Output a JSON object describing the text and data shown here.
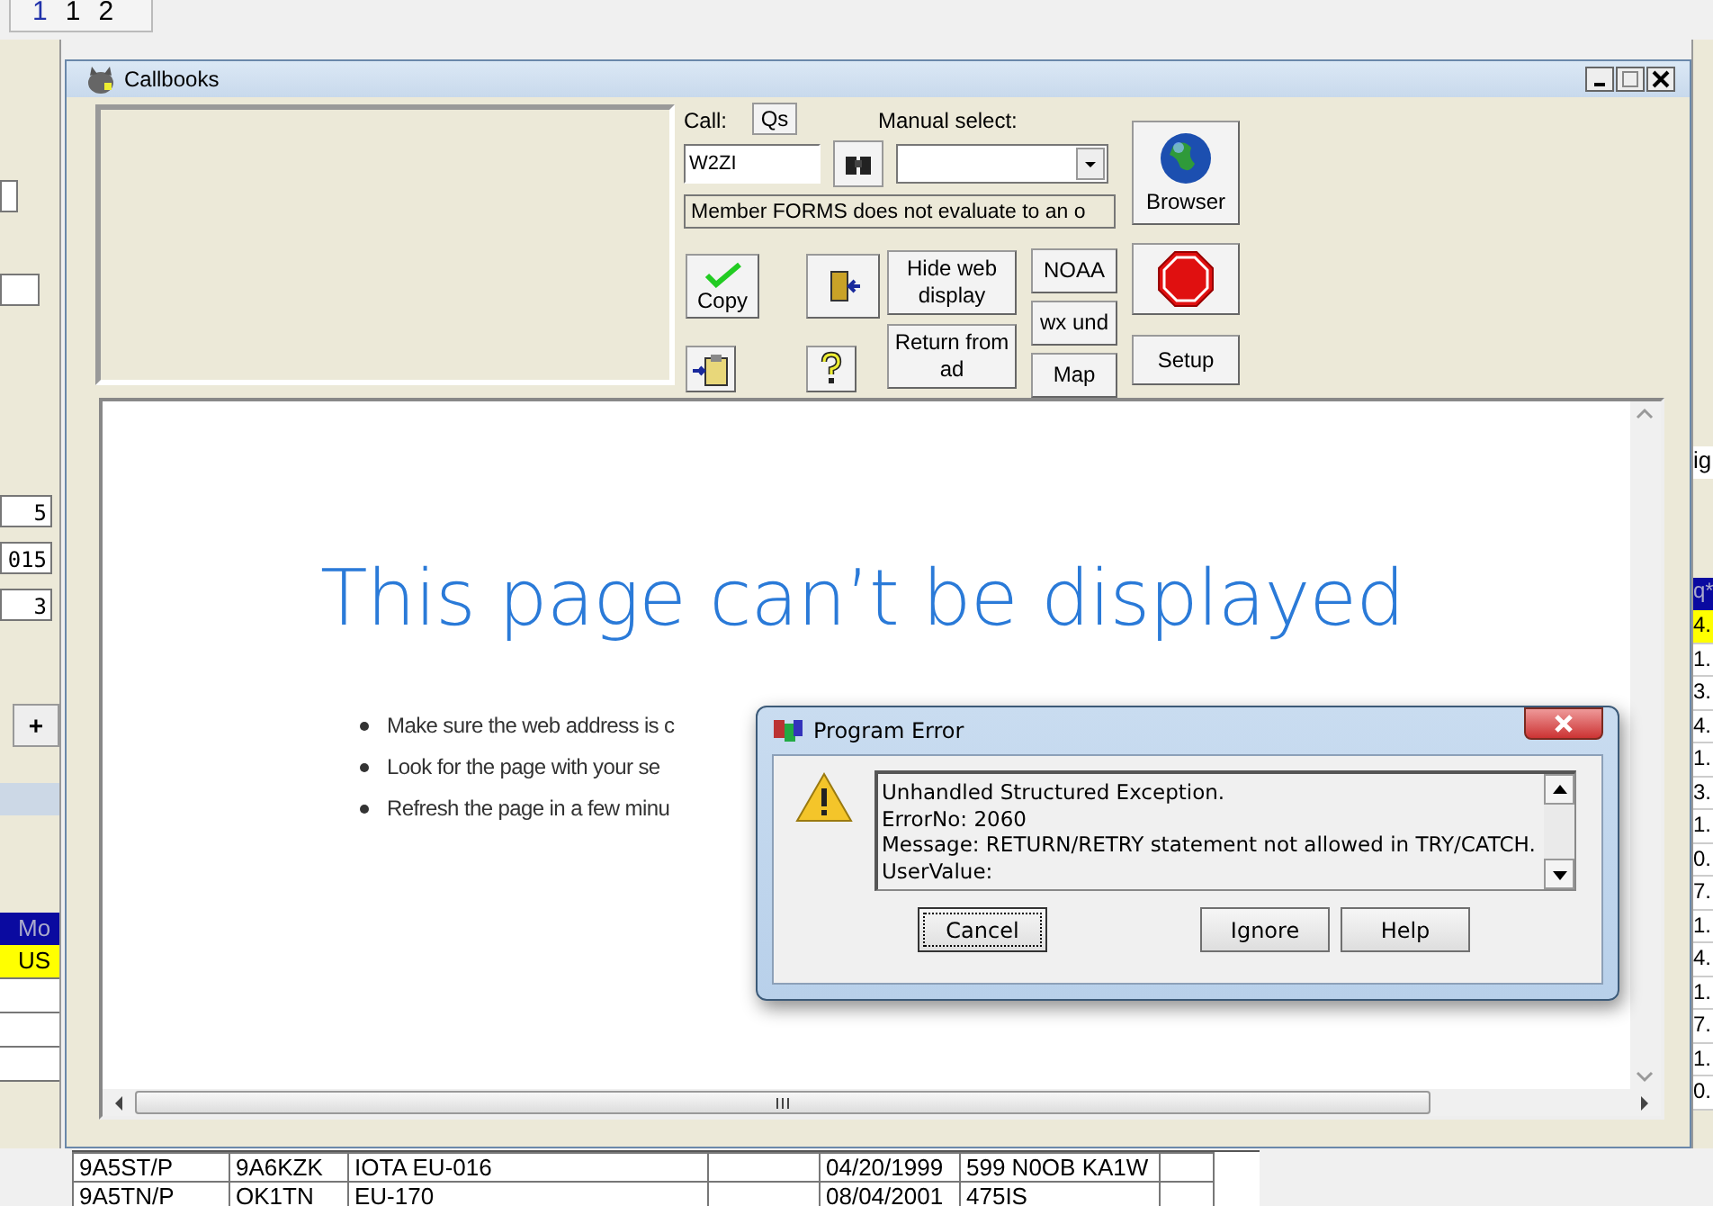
{
  "top_tabs": [
    "1",
    "1",
    "2"
  ],
  "left_pane": {
    "fields": [
      "5",
      "015",
      "3"
    ],
    "plus_button": "+",
    "table": {
      "column": "Mo",
      "rows": [
        {
          "text": "US",
          "selected": true
        }
      ]
    }
  },
  "right_pane": {
    "label": "ig",
    "column": "q*",
    "rows": [
      {
        "text": "4.",
        "selected": true
      },
      {
        "text": "1.",
        "selected": false
      },
      {
        "text": "3.",
        "selected": false
      },
      {
        "text": "4.",
        "selected": false
      },
      {
        "text": "1.",
        "selected": false
      },
      {
        "text": "3.",
        "selected": false
      },
      {
        "text": "1.",
        "selected": false
      },
      {
        "text": "0.",
        "selected": false
      },
      {
        "text": "7.",
        "selected": false
      },
      {
        "text": "1.",
        "selected": false
      },
      {
        "text": "4.",
        "selected": false
      },
      {
        "text": "1.",
        "selected": false
      },
      {
        "text": "7.",
        "selected": false
      },
      {
        "text": "1.",
        "selected": false
      },
      {
        "text": "0.",
        "selected": false
      }
    ]
  },
  "callbooks": {
    "title": "Callbooks",
    "call_label": "Call:",
    "qs_button": "Qs",
    "call_value": "W2ZI",
    "manual_label": "Manual select:",
    "member_text": "Member FORMS does not evaluate to an o",
    "buttons": {
      "copy": "Copy",
      "browser": "Browser",
      "hide": "Hide web display",
      "return": "Return from ad",
      "noaa": "NOAA",
      "wx": "wx und",
      "map": "Map",
      "setup": "Setup"
    },
    "browser": {
      "title": "This page can’t be displayed",
      "bullets": [
        "Make sure the web address is c",
        "Look for the page with your se",
        "Refresh the page in a few minu"
      ]
    }
  },
  "error_dialog": {
    "title": "Program Error",
    "lines": [
      "Unhandled Structured Exception.",
      "ErrorNo: 2060",
      "Message: RETURN/RETRY statement not allowed in TRY/CATCH.",
      "UserValue:"
    ],
    "buttons": [
      {
        "label": "Cancel",
        "focused": true
      },
      {
        "label": "Ignore",
        "focused": false
      },
      {
        "label": "Help",
        "focused": false
      }
    ]
  },
  "bottom_table": {
    "rows": [
      [
        "9A5ST/P",
        "9A6KZK",
        "IOTA EU-016",
        "",
        "04/20/1999",
        "599 N0OB KA1W"
      ],
      [
        "9A5TN/P",
        "OK1TN",
        "EU-170",
        "",
        "08/04/2001",
        "475IS"
      ]
    ]
  }
}
